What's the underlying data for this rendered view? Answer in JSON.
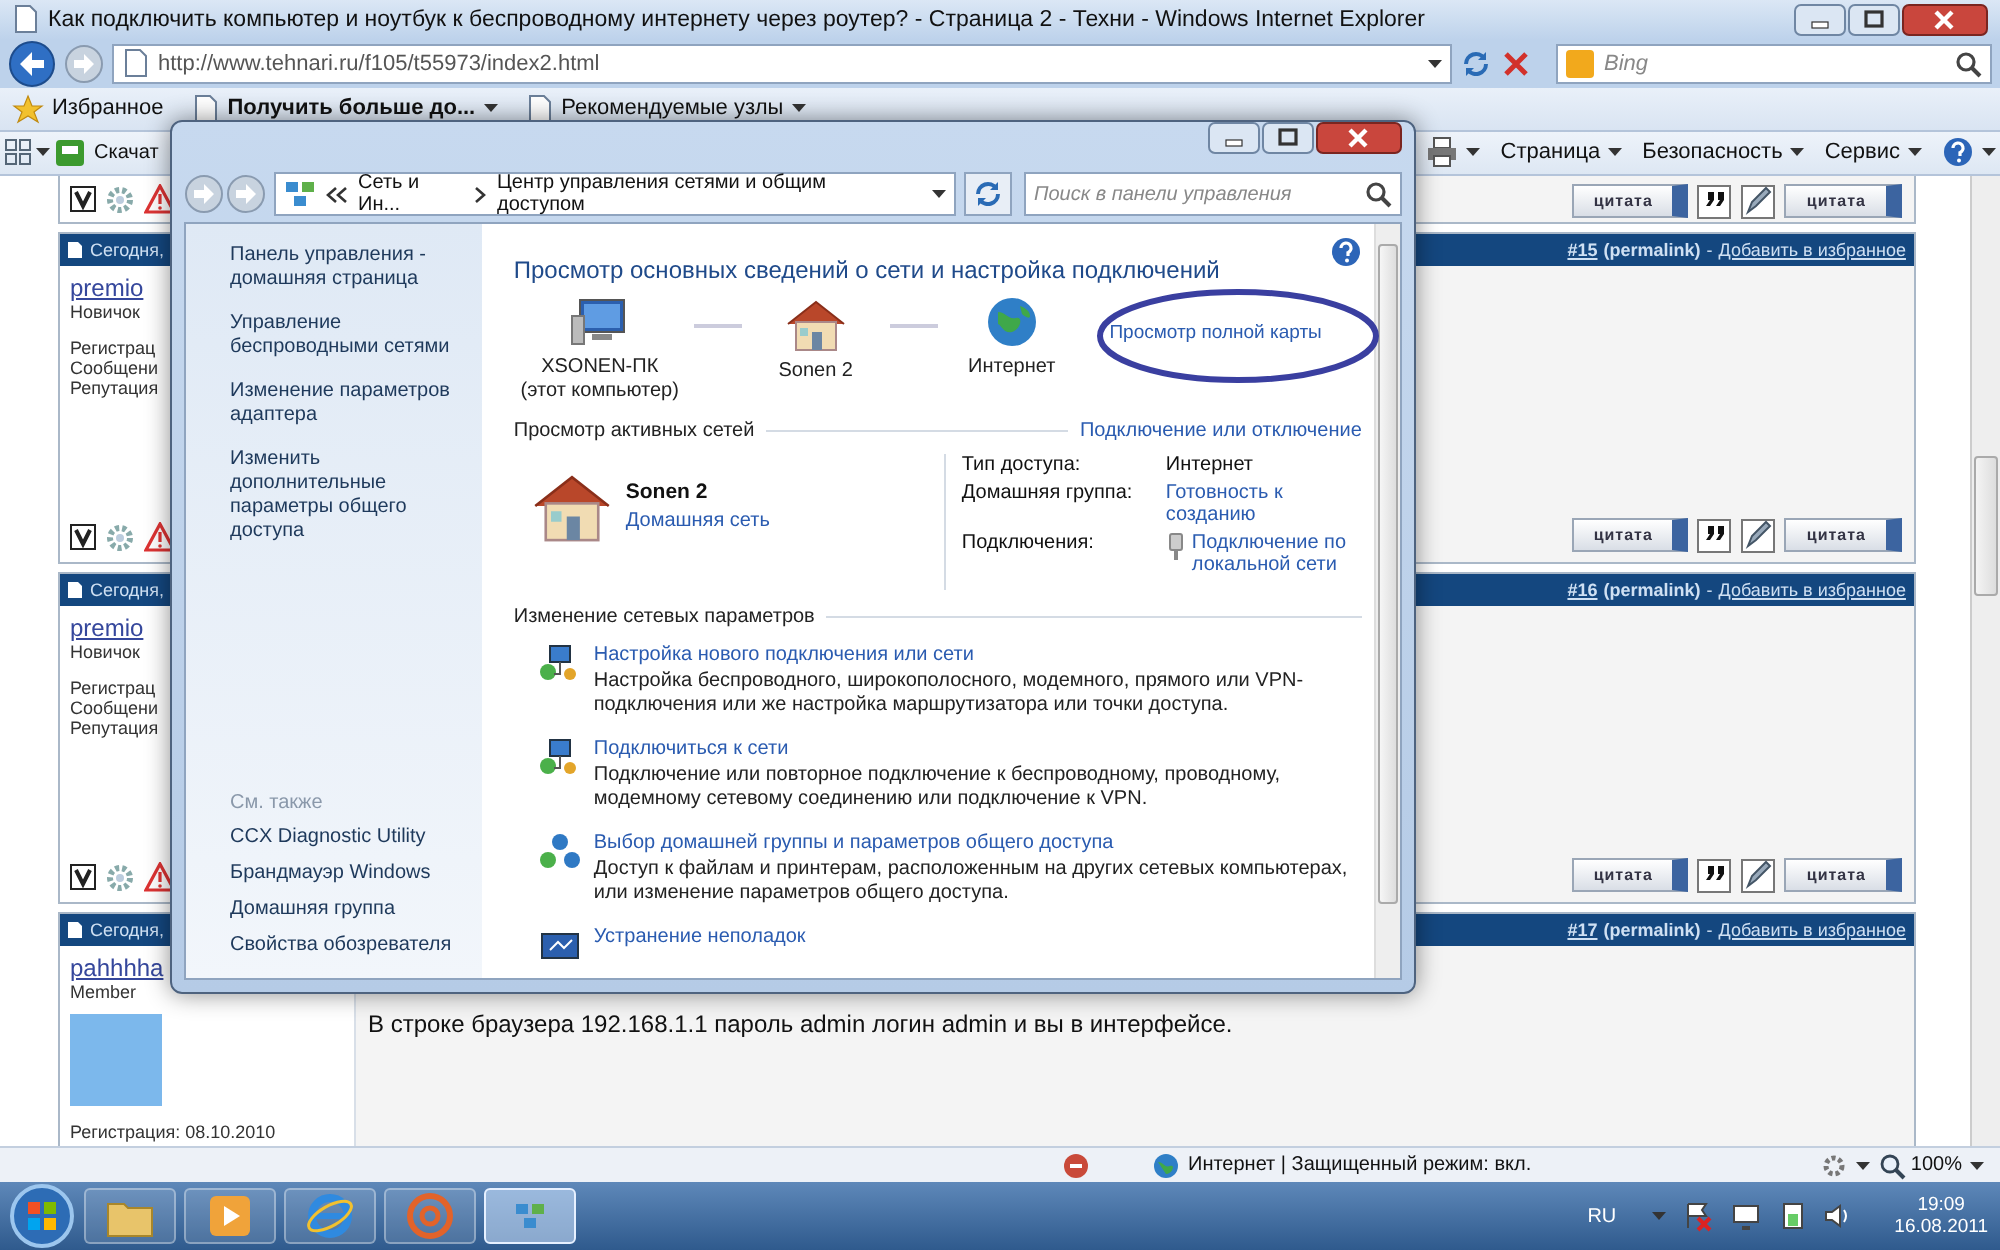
{
  "browser": {
    "title": "Как подключить компьютер и ноутбук к беспроводному интернету через роутер? - Страница 2 - Техни - Windows Internet Explorer",
    "url": "http://www.tehnari.ru/f105/t55973/index2.html",
    "search_placeholder": "Bing"
  },
  "favorites_bar": {
    "favorites": "Избранное",
    "links": [
      "Получить больше до...",
      "Рекомендуемые узлы"
    ]
  },
  "command_bar": {
    "left": "Скачат",
    "menus": [
      "Страница",
      "Безопасность",
      "Сервис"
    ]
  },
  "forum": {
    "tail": {
      "buttons": [
        "цитата",
        "цитата"
      ]
    },
    "posts": [
      {
        "date": "Сегодня,",
        "number": "#15",
        "permalink": "(permalink)",
        "separator": "-",
        "favorite": "Добавить в избранное",
        "user": "premio",
        "rank": "Новичок",
        "avatar": false,
        "info": [
          "Регистрац",
          "Сообщени",
          "Репутация"
        ],
        "buttons": [
          "цитата",
          "цитата"
        ]
      },
      {
        "date": "Сегодня,",
        "number": "#16",
        "permalink": "(permalink)",
        "separator": "-",
        "favorite": "Добавить в избранное",
        "user": "premio",
        "rank": "Новичок",
        "avatar": false,
        "info": [
          "Регистрац",
          "Сообщени",
          "Репутация"
        ],
        "buttons": [
          "цитата",
          "цитата"
        ]
      },
      {
        "date": "Сегодня,",
        "number": "#17",
        "permalink": "(permalink)",
        "separator": "-",
        "favorite": "Добавить в избранное",
        "user": "pahhhha",
        "rank": "Member",
        "avatar": true,
        "info": [
          "Регистрация: 08.10.2010"
        ],
        "message": "В строке браузера 192.168.1.1 пароль admin логин admin и вы в интерфейсе."
      }
    ]
  },
  "control_panel": {
    "breadcrumb": [
      "Сеть и Ин...",
      "Центр управления сетями и общим доступом"
    ],
    "search_placeholder": "Поиск в панели управления",
    "sidebar": {
      "links": [
        "Панель управления - домашняя страница",
        "Управление беспроводными сетями",
        "Изменение параметров адаптера",
        "Изменить дополнительные параметры общего доступа"
      ],
      "see_also_title": "См. также",
      "see_also": [
        "CCX Diagnostic Utility",
        "Брандмауэр Windows",
        "Домашняя группа",
        "Свойства обозревателя"
      ]
    },
    "heading": "Просмотр основных сведений о сети и настройка подключений",
    "map": {
      "nodes": [
        {
          "kind": "computer",
          "label": "XSONEN-ПК",
          "sub": "(этот компьютер)"
        },
        {
          "kind": "house",
          "label": "Sonen  2"
        },
        {
          "kind": "globe",
          "label": "Интернет"
        }
      ],
      "full_map_link": "Просмотр полной карты"
    },
    "active": {
      "title": "Просмотр активных сетей",
      "link": "Подключение или отключение",
      "network": {
        "name": "Sonen  2",
        "type": "Домашняя сеть"
      },
      "properties": [
        {
          "label": "Тип доступа:",
          "value": "Интернет",
          "link": false,
          "icon": false
        },
        {
          "label": "Домашняя группа:",
          "value": "Готовность к созданию",
          "link": true,
          "icon": false
        },
        {
          "label": "Подключения:",
          "value": "Подключение по локальной сети",
          "link": true,
          "icon": true
        }
      ]
    },
    "change": {
      "title": "Изменение сетевых параметров",
      "tasks": [
        {
          "kind": "new-connection",
          "title": "Настройка нового подключения или сети",
          "desc": "Настройка беспроводного, широкополосного, модемного, прямого или VPN-подключения или же настройка маршрутизатора или точки доступа."
        },
        {
          "kind": "connect",
          "title": "Подключиться к сети",
          "desc": "Подключение или повторное подключение к беспроводному, проводному, модемному сетевому соединению или подключение к VPN."
        },
        {
          "kind": "homegroup",
          "title": "Выбор домашней группы и параметров общего доступа",
          "desc": "Доступ к файлам и принтерам, расположенным на других сетевых компьютерах, или изменение параметров общего доступа."
        },
        {
          "kind": "troubleshoot",
          "title": "Устранение неполадок"
        }
      ]
    }
  },
  "status_bar": {
    "zone": "Интернет | Защищенный режим: вкл.",
    "zoom": "100%"
  },
  "taskbar": {
    "items": [
      {
        "kind": "folder",
        "selected": false
      },
      {
        "kind": "media",
        "selected": false
      },
      {
        "kind": "ie",
        "selected": false
      },
      {
        "kind": "mail",
        "selected": false
      },
      {
        "kind": "network",
        "selected": true
      }
    ],
    "language": "RU",
    "time": "19:09",
    "date": "16.08.2011"
  }
}
